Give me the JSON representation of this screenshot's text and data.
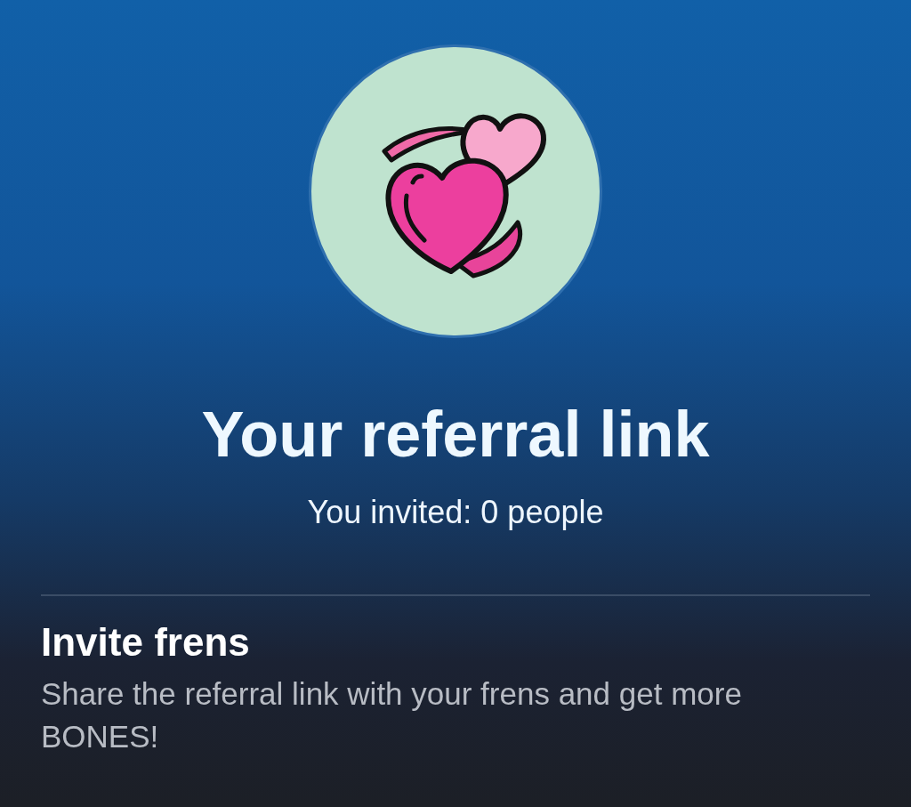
{
  "header": {
    "title": "Your referral link",
    "invited": "You invited: 0 people"
  },
  "invite": {
    "heading": "Invite frens",
    "description": "Share the referral link with your frens and get more BONES!"
  }
}
